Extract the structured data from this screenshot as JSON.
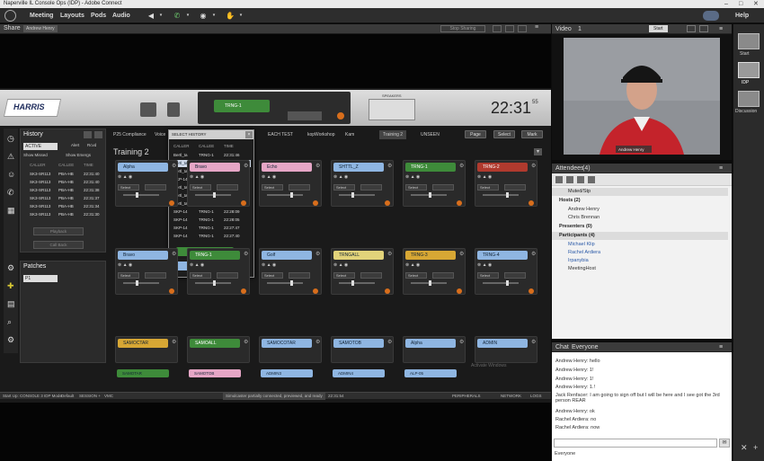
{
  "window": {
    "title": "Naperville IL Console Ops (IDP) - Adobe Connect"
  },
  "menu": {
    "items": [
      "Meeting",
      "Layouts",
      "Pods",
      "Audio"
    ],
    "help": "Help"
  },
  "share": {
    "label": "Share",
    "presenter": "Andrew Henry",
    "stop_sharing": "Stop Sharing"
  },
  "video": {
    "label": "Video",
    "count": "1",
    "start_button": "Start",
    "name_tag": "Andrew Henry"
  },
  "layouts": {
    "items": [
      "Start",
      "IDP",
      "Discussion"
    ]
  },
  "attendees": {
    "label": "Attendees",
    "count": "(4)",
    "active_speakers": "Muted/Stp",
    "hosts_header": "Hosts (2)",
    "hosts": [
      "Andrew Henry",
      "Chris Brennan"
    ],
    "presenters_header": "Presenters (0)",
    "participants_header": "Participants (4)",
    "participants": [
      "Michael Klip",
      "Rachel Ardiera",
      "Irpanybia",
      "MeetingHost"
    ]
  },
  "chat": {
    "label": "Chat",
    "tab": "Everyone",
    "footer_target": "Everyone",
    "messages": [
      "Andrew Henry: hello",
      "Andrew Henry: 1!",
      "Andrew Henry: 1!",
      "Andrew Henry: 1.!",
      "Jack Renfacer: I am going to sign off but I will be here and I see got the 3rd person REAR",
      "Andrew Henry: ok",
      "Rachel Ardiera: no",
      "Rachel Ardiera: now"
    ]
  },
  "console": {
    "brand": "HARRIS",
    "clock": "22:31",
    "clock_seconds": "55",
    "tx_label": "TRNG-1",
    "speakers_label": "SPEAKERS",
    "history": {
      "title": "History",
      "filter": "ACTIVE",
      "opt_a": "Alert",
      "opt_b": "Rcvd",
      "chk_a": "Show Missed",
      "chk_b": "Show Emergs",
      "cols": [
        "CALLER",
        "CALLEE",
        "TIME"
      ],
      "rows": [
        [
          "SK3-SR113",
          "PBA-HB",
          "22:31:40"
        ],
        [
          "SK3-SR113",
          "PBA-HB",
          "22:31:40"
        ],
        [
          "SK3-SR113",
          "PBA-HB",
          "22:31:38"
        ],
        [
          "SK3-SR113",
          "PBA-HB",
          "22:31:37"
        ],
        [
          "SK3-SR113",
          "PBA-HB",
          "22:31:34"
        ],
        [
          "SK3-SR113",
          "PBA-HB",
          "22:31:30"
        ]
      ],
      "btn_a": "Playback",
      "btn_b": "Call Back"
    },
    "patches": {
      "title": "Patches",
      "value": "P1"
    },
    "tabs": [
      "P25 Compliance",
      "Voice",
      "EACH TEST",
      "kopWorkshop",
      "Kam",
      "Training 2",
      "UNSEEN"
    ],
    "page_title": "Training 2",
    "tools": [
      "Page",
      "Select",
      "Mark"
    ],
    "tiles": [
      {
        "name": "Alpha",
        "color": "#8fb6e2"
      },
      {
        "name": "Bravo",
        "color": "#e6a6c6"
      },
      {
        "name": "Echo",
        "color": "#e6a6c6"
      },
      {
        "name": "SHTTL_Z",
        "color": "#8fb6e2"
      },
      {
        "name": "TRNG-1",
        "color": "#3e8b3a"
      },
      {
        "name": "TRNG-2",
        "color": "#b03a2e"
      },
      {
        "name": "Bravo",
        "color": "#8fb6e2"
      },
      {
        "name": "TRNG-1",
        "color": "#3e8b3a"
      },
      {
        "name": "Golf",
        "color": "#8fb6e2"
      },
      {
        "name": "TRNGALL",
        "color": "#e2d37a"
      },
      {
        "name": "TRNG-3",
        "color": "#d7a734"
      },
      {
        "name": "TRNG-4",
        "color": "#8fb6e2"
      },
      {
        "name": "SAMOCTAR",
        "color": "#d7a734"
      },
      {
        "name": "SAMOALL",
        "color": "#3e8b3a"
      },
      {
        "name": "SAMOCOTAR",
        "color": "#8fb6e2"
      },
      {
        "name": "SAMOTOB",
        "color": "#8fb6e2"
      },
      {
        "name": "Alpha",
        "color": "#8fb6e2"
      },
      {
        "name": "ADMIN",
        "color": "#8fb6e2"
      }
    ],
    "bottom_tiles": [
      "SAMOTAR",
      "SAMOTOB",
      "ADMIN3",
      "ADMIN4",
      "ALP-05"
    ],
    "select_btn": "Select",
    "popup": {
      "title": "SELECT HISTORY",
      "cols": [
        "CALLER",
        "CALLEE",
        "TIME"
      ],
      "rows": [
        [
          "Bertl_ta",
          "TRNG-1",
          "22:31:46"
        ],
        [
          "Bertl_ta",
          "TRNG-1",
          "22:31:40"
        ],
        [
          "Bertl_ta",
          "TRNG-1",
          "22:29:51"
        ],
        [
          "SKP-14",
          "TRNG-1",
          "22:29:12"
        ],
        [
          "Bertl_ta",
          "TRNG-1",
          "22:30:36"
        ],
        [
          "Bertl_ta",
          "TRNG-1",
          "22:30:34"
        ],
        [
          "Bertl_ta",
          "TRNG-1",
          "22:30:31"
        ],
        [
          "SKP-14",
          "TRNG-1",
          "22:28:09"
        ],
        [
          "SKP-14",
          "TRNG-1",
          "22:28:05"
        ],
        [
          "SKP-14",
          "TRNG-1",
          "22:27:47"
        ],
        [
          "SKP-14",
          "TRNG-1",
          "22:27:40"
        ]
      ],
      "btn_a": "TRNG-1",
      "btn_b": "ALP-03"
    },
    "status": {
      "left": "Start Up: CONSOLE 3 IDP Mode",
      "mid_a": "Default",
      "mid_b": "SESSION +",
      "mid_c": "VMC",
      "center": "Simulcaster partially connected, previewed, and ready",
      "time": "22:31:54",
      "right_a": "PERIPHERALS",
      "right_b": "NETWORK",
      "right_c": "LOGS"
    },
    "watermark": "Activate Windows"
  }
}
